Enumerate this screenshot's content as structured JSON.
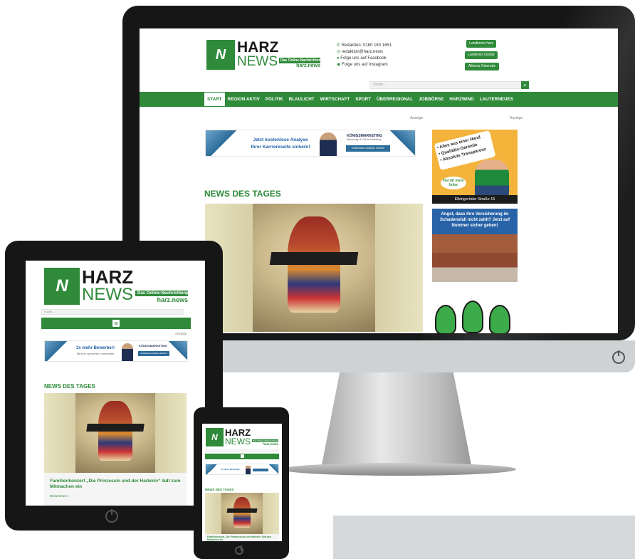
{
  "desktop": {
    "logo": {
      "mark": "N",
      "harz": "HARZ",
      "news": "NEWS",
      "tagline": "Das Online-Nachrichtenportal",
      "domain": "harz.news"
    },
    "contact": [
      {
        "icon": "phone-icon",
        "text": "Redaktion: 0160 160 1651"
      },
      {
        "icon": "whatsapp-icon",
        "text": "redaktion@harz.news"
      },
      {
        "icon": "facebook-icon",
        "text": "Folge uns auf Facebook"
      },
      {
        "icon": "instagram-icon",
        "text": "Folge uns auf Instagram"
      }
    ],
    "district_buttons": [
      "Landkreis Harz",
      "Landkreis Goslar",
      "Altkreis Osterode"
    ],
    "search_placeholder": "Suche...",
    "nav": [
      "START",
      "REGION AKTIV",
      "POLITIK",
      "BLAULICHT",
      "WIRTSCHAFT",
      "SPORT",
      "ÜBERREGIONAL",
      "JOBBÖRSE",
      "HARZWIND",
      "LAUTERNEUES"
    ],
    "anzeige": "Anzeige",
    "banner": {
      "line1": "Jetzt kostenlose Analyse",
      "line2": "Ihrer Karriereseite sichern!",
      "brand": "KÖNIGSMARKETING",
      "brand_sub": "Webdesign & Online Marketing",
      "cta": "Kostenlose Analyse sichern"
    },
    "section_title": "NEWS DES TAGES",
    "side_ad1": {
      "lines": [
        "• Alles aus einer Hand",
        "• Qualitäts-Garantie",
        "• Absolute Transparenz"
      ],
      "badge": "Hol dir mehr Infos",
      "footer": "Elbingeröder Straße 15"
    },
    "side_ad2": {
      "text": "Angst, dass Ihre Versicherung im Schadensfall nicht zahlt? Jetzt auf Nummer sicher gehen!"
    }
  },
  "tablet": {
    "search_placeholder": "Suche...",
    "anzeige": "Anzeige",
    "banner": {
      "line1": "3x mehr Bewerber!",
      "line2": "Mit einer optimierten Karriereseite",
      "brand": "KÖNIGSMARKETING",
      "cta": "Kostenlose Analyse sichern"
    },
    "section_title": "NEWS DES TAGES",
    "headline": "Familienkonzert „Die Prinzessin und der Harlekin“ lädt zum Mitmachen ein",
    "more": "Weiterlesen »"
  },
  "phone": {
    "section_title": "NEWS DES TAGES",
    "banner": {
      "line1": "3x mehr Bewerber!"
    },
    "headline": "Familienkonzert „Die Prinzessin und der Harlekin“ lädt zum Mitmachen ein"
  },
  "colors": {
    "brand_green": "#2f8a3a",
    "device_black": "#161616",
    "link_blue": "#1f5fa8"
  }
}
